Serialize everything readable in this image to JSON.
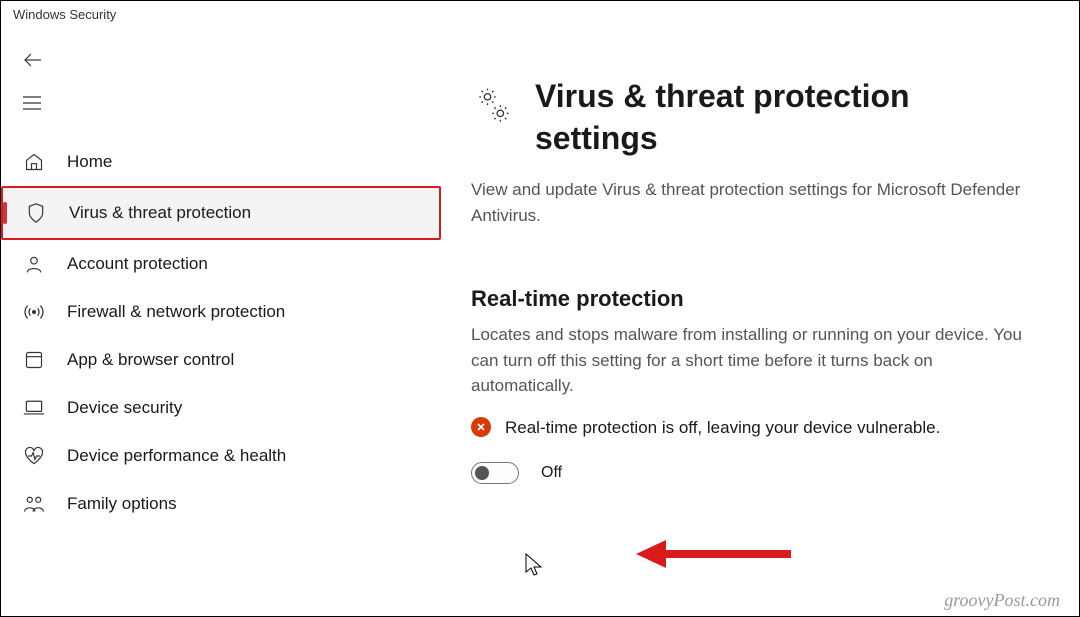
{
  "window": {
    "title": "Windows Security"
  },
  "sidebar": {
    "items": [
      {
        "icon": "home",
        "label": "Home"
      },
      {
        "icon": "shield",
        "label": "Virus & threat protection",
        "active": true
      },
      {
        "icon": "person",
        "label": "Account protection"
      },
      {
        "icon": "antenna",
        "label": "Firewall & network protection"
      },
      {
        "icon": "app",
        "label": "App & browser control"
      },
      {
        "icon": "laptop",
        "label": "Device security"
      },
      {
        "icon": "heart",
        "label": "Device performance & health"
      },
      {
        "icon": "family",
        "label": "Family options"
      }
    ]
  },
  "page": {
    "title": "Virus & threat protection settings",
    "description": "View and update Virus & threat protection settings for Microsoft Defender Antivirus."
  },
  "section": {
    "title": "Real-time protection",
    "description": "Locates and stops malware from installing or running on your device. You can turn off this setting for a short time before it turns back on automatically.",
    "warning": "Real-time protection is off, leaving your device vulnerable.",
    "toggle_state": "Off"
  },
  "watermark": "groovyPost.com"
}
